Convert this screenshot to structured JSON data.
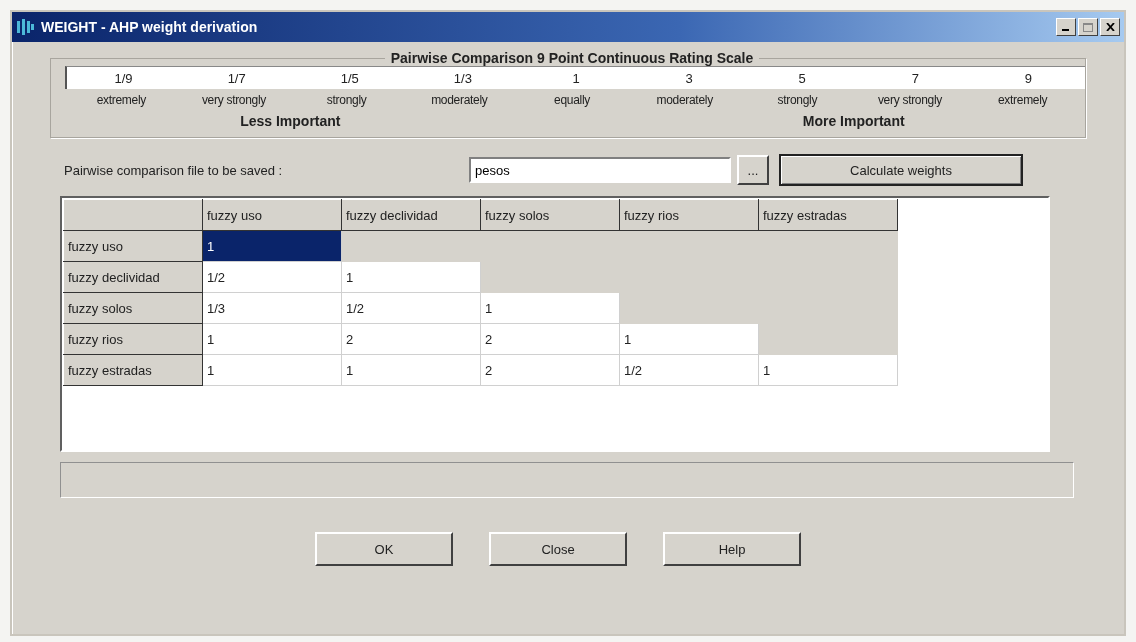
{
  "window": {
    "title": "WEIGHT - AHP weight derivation"
  },
  "scale": {
    "title": "Pairwise Comparison 9 Point Continuous Rating Scale",
    "points": [
      {
        "value": "1/9",
        "label": "extremely"
      },
      {
        "value": "1/7",
        "label": "very strongly"
      },
      {
        "value": "1/5",
        "label": "strongly"
      },
      {
        "value": "1/3",
        "label": "moderately"
      },
      {
        "value": "1",
        "label": "equally"
      },
      {
        "value": "3",
        "label": "moderately"
      },
      {
        "value": "5",
        "label": "strongly"
      },
      {
        "value": "7",
        "label": "very strongly"
      },
      {
        "value": "9",
        "label": "extremely"
      }
    ],
    "left_caption": "Less Important",
    "right_caption": "More Important"
  },
  "file": {
    "label": "Pairwise comparison file to be saved :",
    "value": "pesos",
    "browse": "...",
    "calculate": "Calculate weights"
  },
  "matrix": {
    "columns": [
      "fuzzy uso",
      "fuzzy declividad",
      "fuzzy solos",
      "fuzzy rios",
      "fuzzy estradas"
    ],
    "rows": [
      {
        "header": "fuzzy uso",
        "cells": [
          {
            "value": "1",
            "selected": true,
            "disabled": false
          },
          {
            "selected": false,
            "disabled": true
          },
          {
            "selected": false,
            "disabled": true
          },
          {
            "selected": false,
            "disabled": true
          },
          {
            "selected": false,
            "disabled": true
          }
        ]
      },
      {
        "header": "fuzzy declividad",
        "cells": [
          {
            "value": "1/2",
            "selected": false,
            "disabled": false
          },
          {
            "value": "1",
            "selected": false,
            "disabled": false
          },
          {
            "selected": false,
            "disabled": true
          },
          {
            "selected": false,
            "disabled": true
          },
          {
            "selected": false,
            "disabled": true
          }
        ]
      },
      {
        "header": "fuzzy solos",
        "cells": [
          {
            "value": "1/3",
            "selected": false,
            "disabled": false
          },
          {
            "value": "1/2",
            "selected": false,
            "disabled": false
          },
          {
            "value": "1",
            "selected": false,
            "disabled": false
          },
          {
            "selected": false,
            "disabled": true
          },
          {
            "selected": false,
            "disabled": true
          }
        ]
      },
      {
        "header": "fuzzy rios",
        "cells": [
          {
            "value": "1",
            "selected": false,
            "disabled": false
          },
          {
            "value": "2",
            "selected": false,
            "disabled": false
          },
          {
            "value": "2",
            "selected": false,
            "disabled": false
          },
          {
            "value": "1",
            "selected": false,
            "disabled": false
          },
          {
            "selected": false,
            "disabled": true
          }
        ]
      },
      {
        "header": "fuzzy estradas",
        "cells": [
          {
            "value": "1",
            "selected": false,
            "disabled": false
          },
          {
            "value": "1",
            "selected": false,
            "disabled": false
          },
          {
            "value": "2",
            "selected": false,
            "disabled": false
          },
          {
            "value": "1/2",
            "selected": false,
            "disabled": false
          },
          {
            "value": "1",
            "selected": false,
            "disabled": false
          }
        ]
      }
    ]
  },
  "buttons": [
    "OK",
    "Close",
    "Help"
  ]
}
